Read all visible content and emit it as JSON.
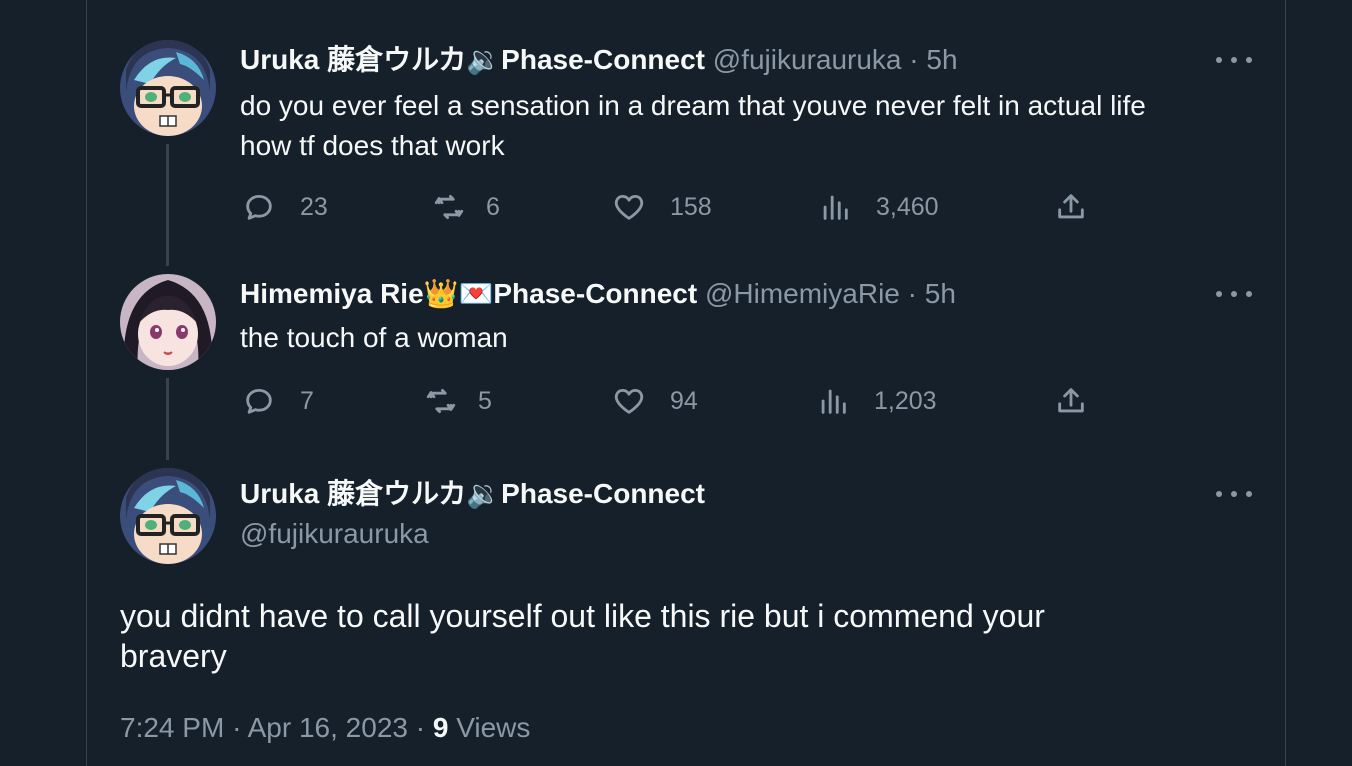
{
  "tweet1": {
    "name": "Uruka 藤倉ウルカ🔉Phase-Connect",
    "handle": "@fujikurauruka",
    "separator": "·",
    "time": "5h",
    "text_line1": "do you ever feel a sensation in a dream that youve never felt in actual life",
    "text_line2": "how tf does that work",
    "replies": "23",
    "retweets": "6",
    "likes": "158",
    "views": "3,460"
  },
  "tweet2": {
    "name": "Himemiya Rie👑💌Phase-Connect",
    "handle": "@HimemiyaRie",
    "separator": "·",
    "time": "5h",
    "text": "the touch of a woman",
    "replies": "7",
    "retweets": "5",
    "likes": "94",
    "views": "1,203"
  },
  "main_tweet": {
    "name": "Uruka 藤倉ウルカ🔉Phase-Connect",
    "handle": "@fujikurauruka",
    "text_line1": "you didnt have to call yourself out like this rie but i commend your",
    "text_line2": "bravery",
    "time": "7:24 PM",
    "date": "Apr 16, 2023",
    "separator": "·",
    "views_count": "9",
    "views_label": "Views"
  },
  "colors": {
    "background": "#15202b",
    "border": "#38444d",
    "text_primary": "#f7f9f9",
    "text_secondary": "#8b98a5"
  }
}
